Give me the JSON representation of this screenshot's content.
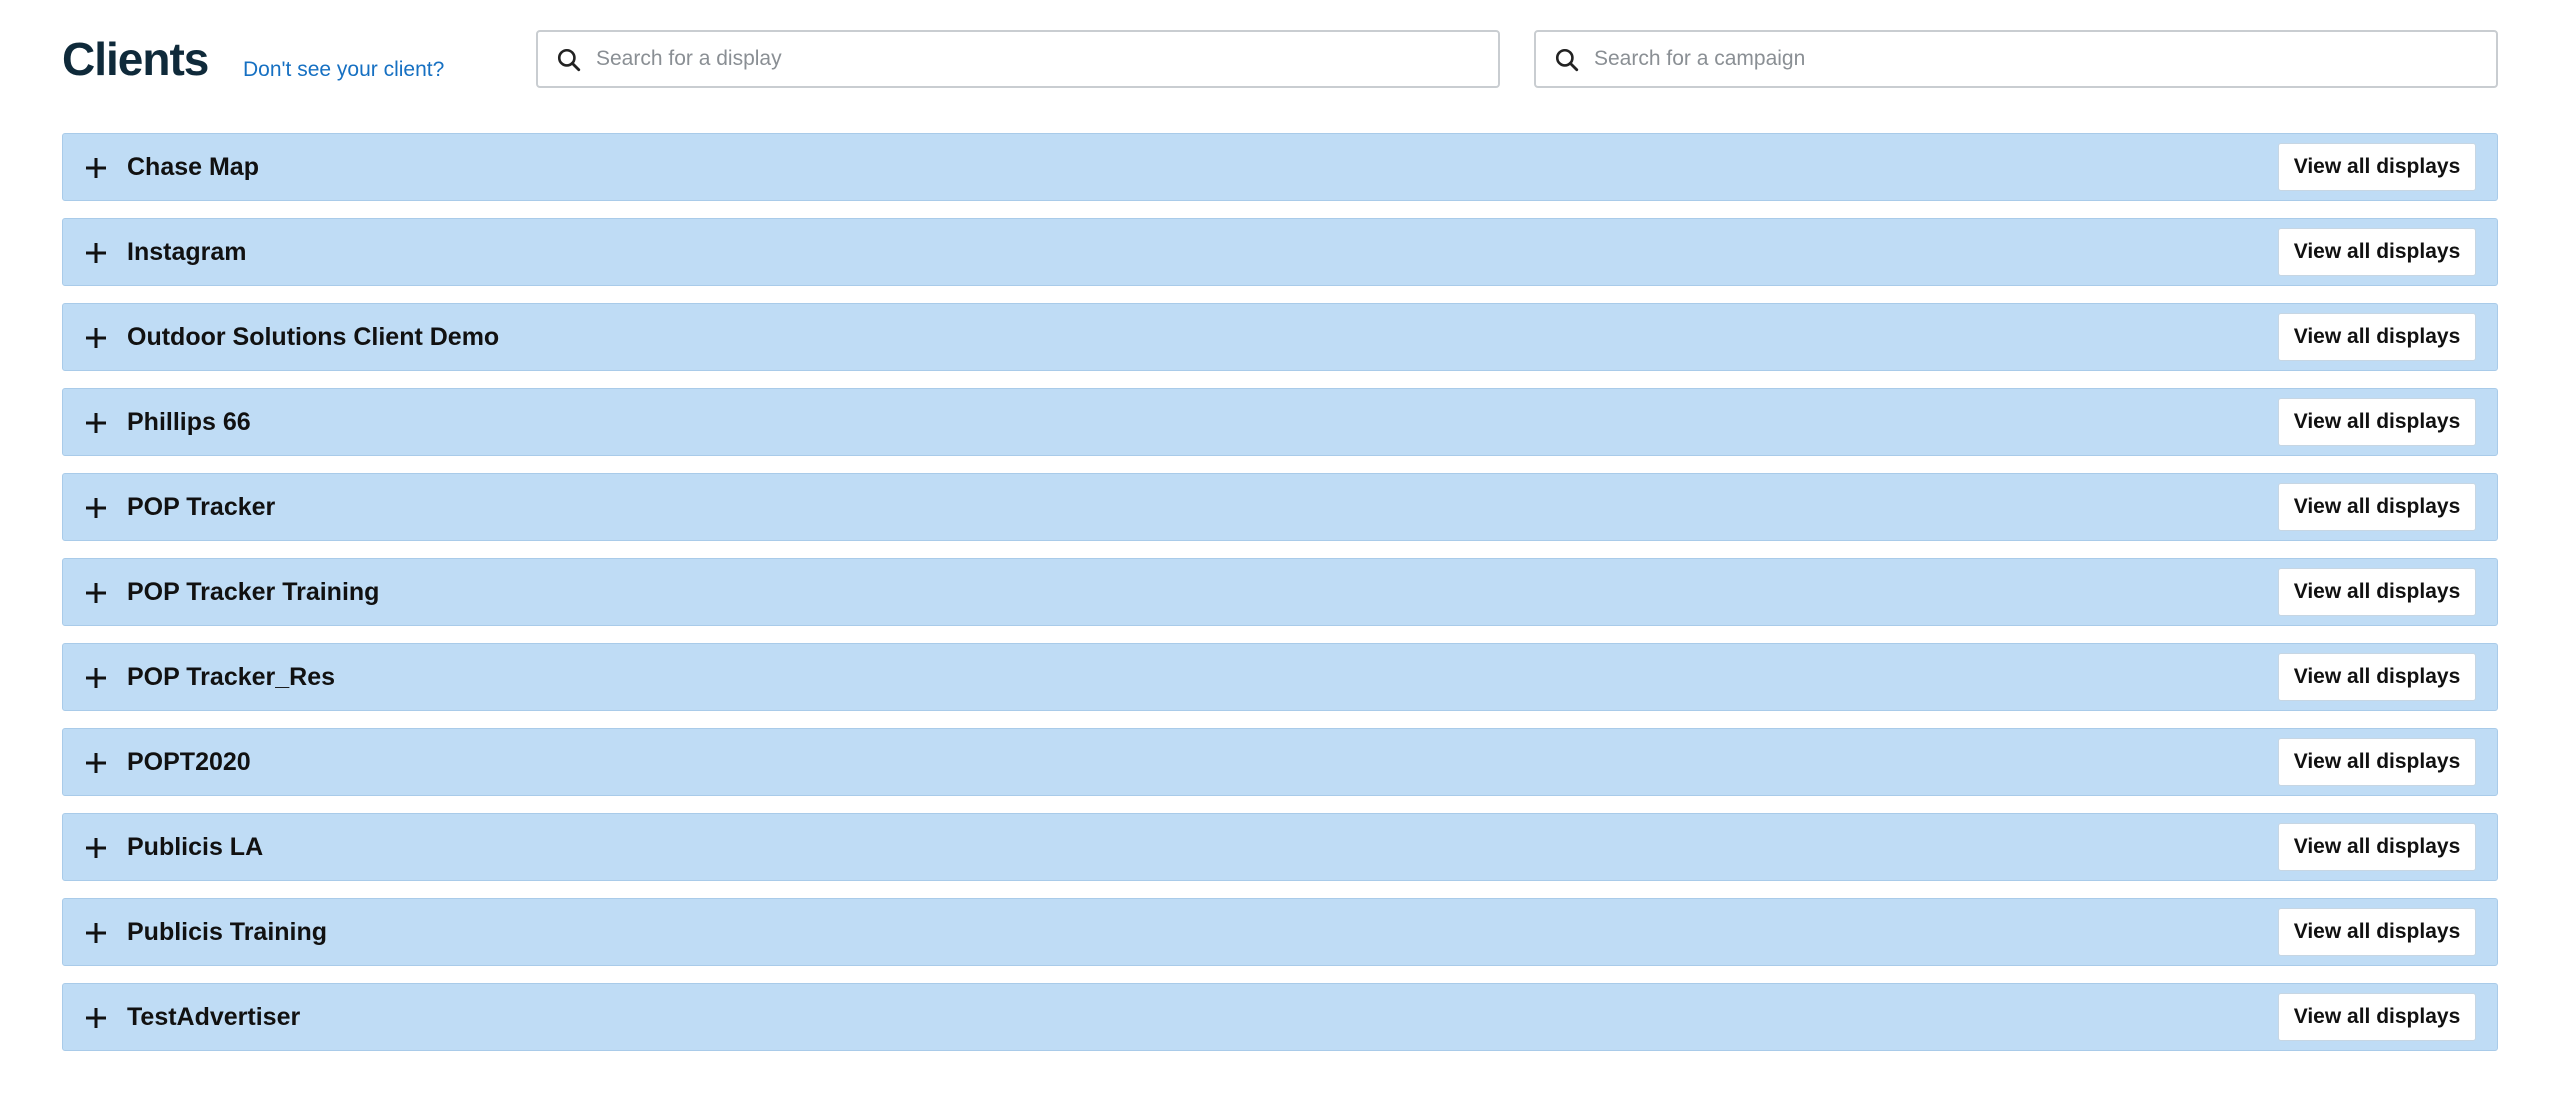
{
  "header": {
    "title": "Clients",
    "missing_client_link": "Don't see your client?"
  },
  "search": {
    "display_placeholder": "Search for a display",
    "campaign_placeholder": "Search for a campaign"
  },
  "clients": [
    {
      "name": "Chase Map",
      "action_label": "View all displays"
    },
    {
      "name": "Instagram",
      "action_label": "View all displays"
    },
    {
      "name": "Outdoor Solutions Client Demo",
      "action_label": "View all displays"
    },
    {
      "name": "Phillips 66",
      "action_label": "View all displays"
    },
    {
      "name": "POP Tracker",
      "action_label": "View all displays"
    },
    {
      "name": "POP Tracker Training",
      "action_label": "View all displays"
    },
    {
      "name": "POP Tracker_Res",
      "action_label": "View all displays"
    },
    {
      "name": "POPT2020",
      "action_label": "View all displays"
    },
    {
      "name": "Publicis LA",
      "action_label": "View all displays"
    },
    {
      "name": "Publicis Training",
      "action_label": "View all displays"
    },
    {
      "name": "TestAdvertiser",
      "action_label": "View all displays"
    }
  ],
  "icons": {
    "search": "search-icon",
    "expand": "plus-icon"
  },
  "colors": {
    "row_background": "#bfdcf5",
    "link": "#1670c2",
    "title": "#0f2a3a"
  }
}
